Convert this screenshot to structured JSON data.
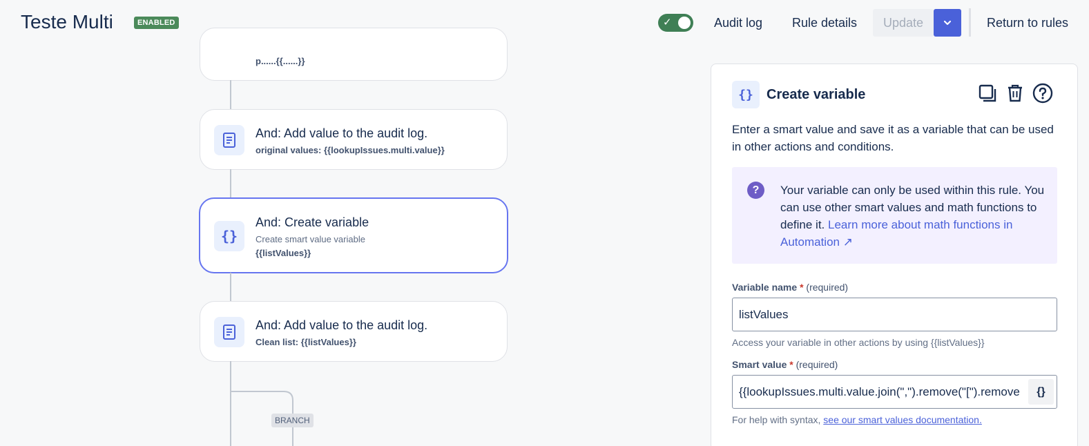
{
  "header": {
    "title": "Teste Multi",
    "status_badge": "ENABLED",
    "toggle_enabled": true,
    "audit_log": "Audit log",
    "rule_details": "Rule details",
    "update": "Update",
    "return_to_rules": "Return to rules"
  },
  "canvas": {
    "partial_card_text": "p......{{......}}",
    "cards": [
      {
        "title": "And: Add value to the audit log.",
        "subtitle": "original values: {{lookupIssues.multi.value}}",
        "icon": "document-icon"
      },
      {
        "title": "And: Create variable",
        "description": "Create smart value variable",
        "subtitle": "{{listValues}}",
        "icon": "curly-braces-icon",
        "selected": true
      },
      {
        "title": "And: Add value to the audit log.",
        "subtitle": "Clean list: {{listValues}}",
        "icon": "document-icon"
      }
    ],
    "branch_label": "BRANCH"
  },
  "panel": {
    "title": "Create variable",
    "description": "Enter a smart value and save it as a variable that can be used in other actions and conditions.",
    "info_text": "Your variable can only be used within this rule. You can use other smart values and math functions to define it.",
    "info_link": "Learn more about math functions in Automation ↗",
    "variable_name_label": "Variable name",
    "required_mark": "*",
    "required_hint": "(required)",
    "variable_name_value": "listValues",
    "variable_helper": "Access your variable in other actions by using {{listValues}}",
    "smart_value_label": "Smart value",
    "smart_value_value": "{{lookupIssues.multi.value.join(\",\").remove(\"[\").remove",
    "smart_value_button": "{}",
    "syntax_helper_prefix": "For help with syntax,",
    "syntax_helper_link": "see our smart values documentation."
  },
  "colors": {
    "accent": "#4a61d9",
    "enabled_badge": "#4b8a5a",
    "toggle_on": "#3f7f55",
    "info_background": "#f3f0ff"
  }
}
